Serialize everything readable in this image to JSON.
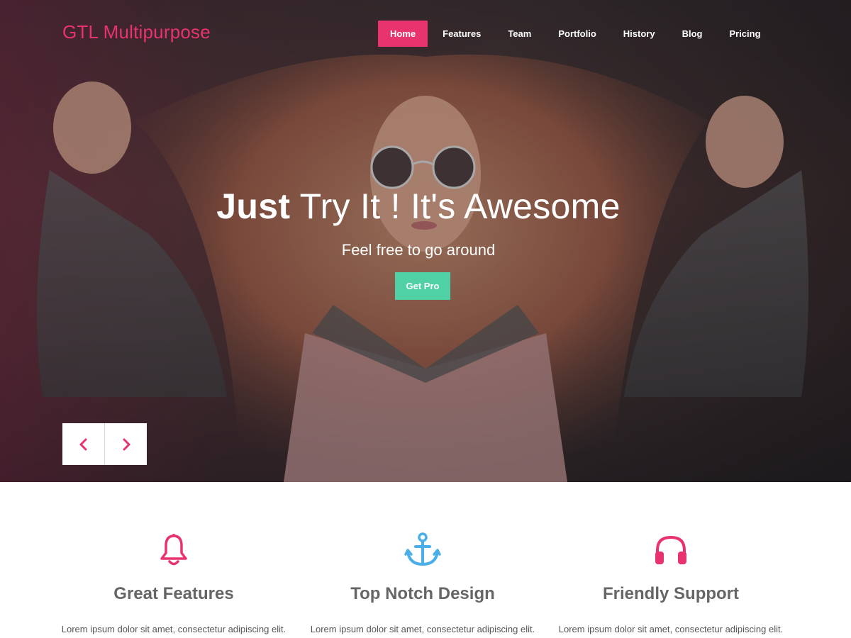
{
  "header": {
    "brand": "GTL Multipurpose",
    "nav": [
      "Home",
      "Features",
      "Team",
      "Portfolio",
      "History",
      "Blog",
      "Pricing"
    ],
    "active_nav": "Home"
  },
  "hero": {
    "title_bold": "Just",
    "title_rest": " Try It ! It's Awesome",
    "subtitle": "Feel free to go around",
    "cta_label": "Get Pro",
    "prev_icon": "chevron-left-icon",
    "next_icon": "chevron-right-icon"
  },
  "features": [
    {
      "icon": "bell-icon",
      "title": "Great Features",
      "text": "Lorem ipsum dolor sit amet, consectetur adipiscing elit."
    },
    {
      "icon": "anchor-icon",
      "title": "Top Notch Design",
      "text": "Lorem ipsum dolor sit amet, consectetur adipiscing elit."
    },
    {
      "icon": "headphones-icon",
      "title": "Friendly Support",
      "text": "Lorem ipsum dolor sit amet, consectetur adipiscing elit."
    }
  ],
  "colors": {
    "accent": "#e8336f",
    "cta": "#4fd1a5",
    "anchor_icon": "#4aaee8",
    "heading": "#666666"
  }
}
